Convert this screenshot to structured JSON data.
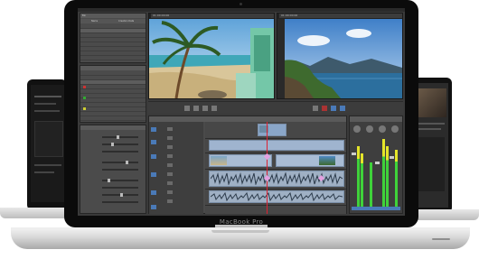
{
  "laptop": {
    "brand_label": "MacBook Pro"
  },
  "app": {
    "bin_header": "Bin",
    "bin_columns": [
      "Name",
      "Creation Date"
    ],
    "timecode_left": "01:00:00:00",
    "timecode_right": "01:00:00:00"
  },
  "colors": {
    "accent_blue": "#4a7ab8",
    "meter_green": "#3fd23a",
    "meter_yellow": "#e4e52a",
    "ui_gray": "#4b4b4b"
  }
}
